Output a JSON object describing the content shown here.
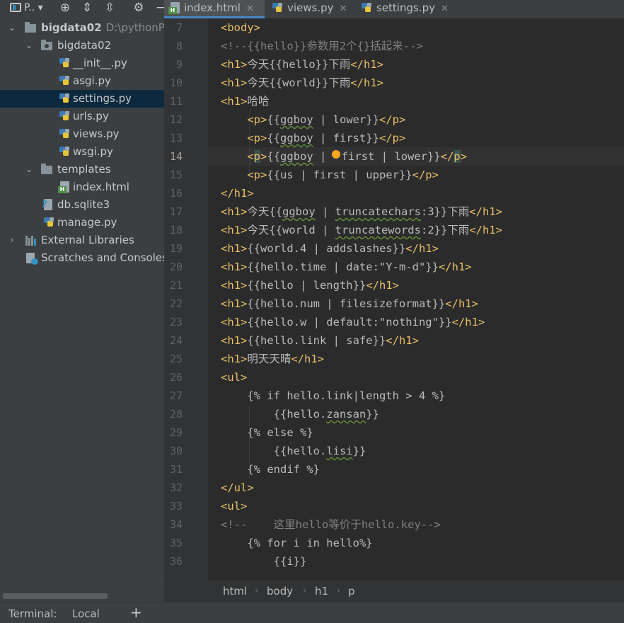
{
  "project_panel": {
    "title": "P..",
    "toolbar_icons": [
      "locate-icon",
      "expand-all-icon",
      "collapse-all-icon",
      "gear-icon",
      "hide-icon"
    ],
    "tree": [
      {
        "label": "bigdata02",
        "path": "D:\\pythonPro",
        "type": "project-root",
        "expanded": true
      },
      {
        "label": "bigdata02",
        "type": "package",
        "expanded": true
      },
      {
        "label": "__init__.py",
        "type": "py"
      },
      {
        "label": "asgi.py",
        "type": "py"
      },
      {
        "label": "settings.py",
        "type": "py",
        "selected": true
      },
      {
        "label": "urls.py",
        "type": "py"
      },
      {
        "label": "views.py",
        "type": "py"
      },
      {
        "label": "wsgi.py",
        "type": "py"
      },
      {
        "label": "templates",
        "type": "folder",
        "expanded": true
      },
      {
        "label": "index.html",
        "type": "html"
      },
      {
        "label": "db.sqlite3",
        "type": "db"
      },
      {
        "label": "manage.py",
        "type": "py"
      },
      {
        "label": "External Libraries",
        "type": "libs",
        "expanded": false
      },
      {
        "label": "Scratches and Consoles",
        "type": "scratch"
      }
    ]
  },
  "tabs": [
    {
      "label": "index.html",
      "active": true
    },
    {
      "label": "views.py",
      "active": false
    },
    {
      "label": "settings.py",
      "active": false
    }
  ],
  "editor": {
    "current_line": 14,
    "line_numbers": [
      "7",
      "8",
      "9",
      "10",
      "11",
      "12",
      "13",
      "14",
      "15",
      "16",
      "17",
      "18",
      "19",
      "20",
      "21",
      "22",
      "23",
      "24",
      "25",
      "26",
      "27",
      "28",
      "29",
      "30",
      "31",
      "32",
      "33",
      "34",
      "35",
      "36"
    ]
  },
  "breadcrumbs": [
    "html",
    "body",
    "h1",
    "p"
  ],
  "terminal": {
    "title": "Terminal:",
    "tab": "Local",
    "add": "+"
  },
  "colors": {
    "tag": "#e8bf6a",
    "comment": "#808080",
    "text": "#a9b7c6",
    "selection": "#0d293e",
    "background": "#2b2b2b"
  }
}
